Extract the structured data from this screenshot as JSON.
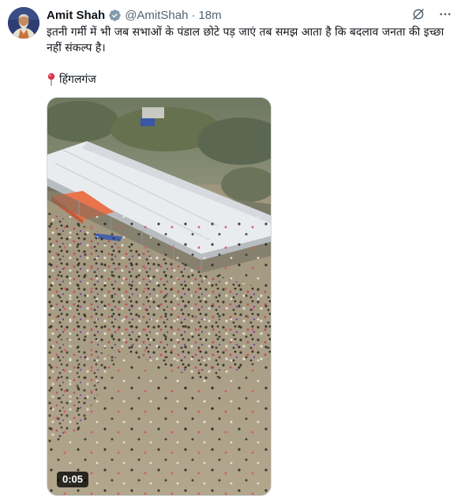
{
  "tweet": {
    "author_name": "Amit Shah",
    "handle": "@AmitShah",
    "separator": "·",
    "time": "18m",
    "text": "इतनी गर्मी में भी जब सभाओं के पंडाल छोटे पड़ जाएं तब समझ आता है कि बदलाव जनता की इच्छा नहीं संकल्प है।",
    "location": "हिंगलगंज",
    "verified_color": "#829aab",
    "video_duration": "0:05"
  },
  "icons": {
    "verified": "verified-badge-icon",
    "grok": "grok-icon",
    "more": "more-dots-icon",
    "pin": "round-pushpin-icon"
  }
}
